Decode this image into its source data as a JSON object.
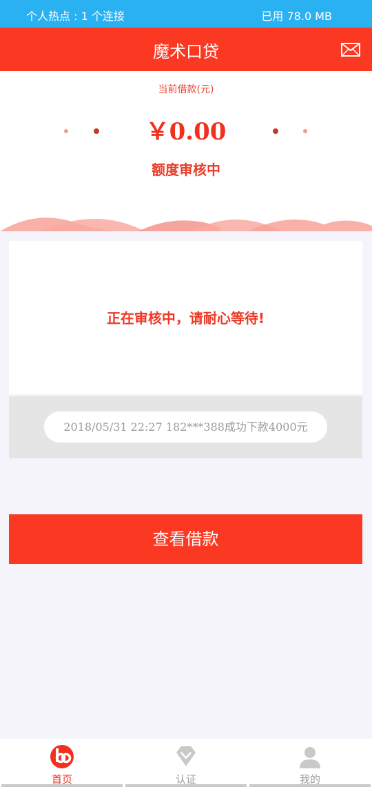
{
  "status_bar": {
    "hotspot": "个人热点 : 1 个连接",
    "data_used": "已用 78.0 MB"
  },
  "header": {
    "title": "魔术口贷",
    "mail_icon": "mail-icon"
  },
  "loan": {
    "caption": "当前借款(元)",
    "amount": "￥0.00",
    "status": "额度审核中"
  },
  "review_card": {
    "message": "正在审核中，请耐心等待!"
  },
  "ticker": {
    "text": "2018/05/31 22:27 182***388成功下款4000元"
  },
  "action_button": {
    "label": "查看借款"
  },
  "tabs": [
    {
      "label": "首页",
      "icon": "home-logo-icon",
      "active": true
    },
    {
      "label": "认证",
      "icon": "diamond-icon",
      "active": false
    },
    {
      "label": "我的",
      "icon": "user-icon",
      "active": false
    }
  ],
  "colors": {
    "status_bar": "#29b1f2",
    "primary_red": "#fb3822",
    "wave_pink": "#f7a29a"
  }
}
